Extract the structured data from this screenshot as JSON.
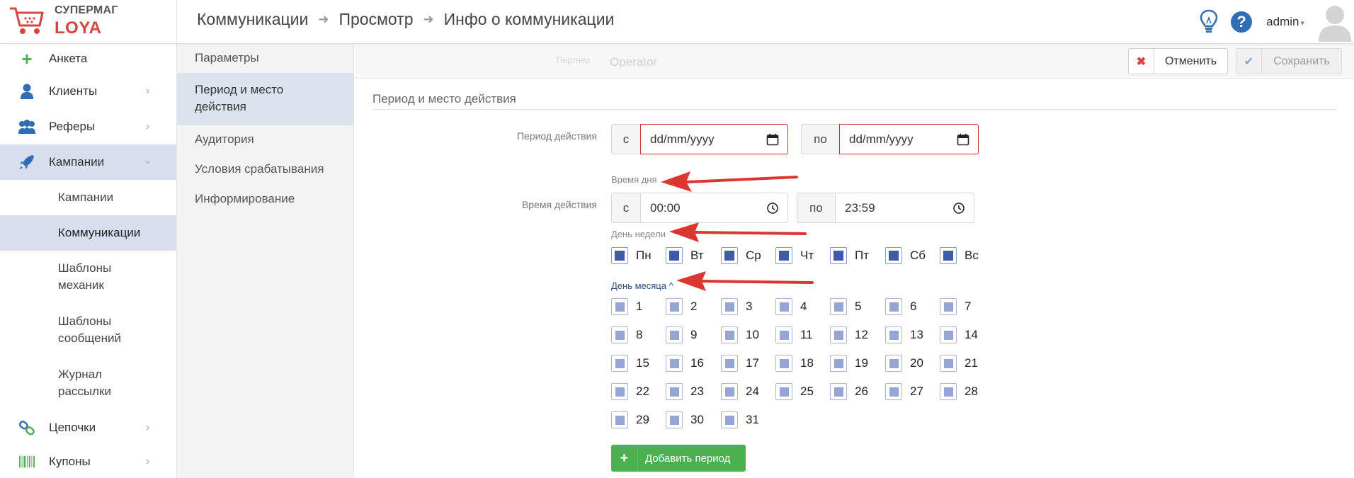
{
  "brand": {
    "line1": "СУПЕРМАГ",
    "line2": "LOYA",
    "accent": "#d9443f"
  },
  "breadcrumbs": [
    "Коммуникации",
    "Просмотр",
    "Инфо о коммуникации"
  ],
  "header": {
    "user": "admin"
  },
  "sidebar": {
    "items": [
      {
        "label": "Анкета",
        "icon": "plus-icon"
      },
      {
        "label": "Клиенты",
        "icon": "user-icon"
      },
      {
        "label": "Реферы",
        "icon": "users-icon"
      },
      {
        "label": "Кампании",
        "icon": "rocket-icon",
        "active": true
      }
    ],
    "subitems": [
      {
        "label": "Кампании"
      },
      {
        "label": "Коммуникации",
        "active": true
      },
      {
        "label": "Шаблоны механик"
      },
      {
        "label": "Шаблоны сообщений"
      },
      {
        "label": "Журнал рассылки"
      }
    ],
    "bottom": [
      {
        "label": "Цепочки",
        "icon": "chain-icon"
      },
      {
        "label": "Купоны",
        "icon": "barcode-icon"
      }
    ]
  },
  "submenu": {
    "items": [
      {
        "label": "Параметры"
      },
      {
        "label": "Период и место действия",
        "active": true
      },
      {
        "label": "Аудитория"
      },
      {
        "label": "Условия срабатывания"
      },
      {
        "label": "Информирование"
      }
    ]
  },
  "actionbar": {
    "partner_label": "Партнер",
    "partner_value": "Operator",
    "cancel": "Отменить",
    "save": "Сохранить"
  },
  "form": {
    "section_title": "Период и место действия",
    "period": {
      "label": "Период действия",
      "from_prefix": "с",
      "from_placeholder": "dd/mm/yyyy",
      "to_prefix": "по",
      "to_placeholder": "dd/mm/yyyy"
    },
    "time": {
      "hint": "Время дня",
      "label": "Время действия",
      "from_prefix": "с",
      "from_value": "00:00",
      "to_prefix": "по",
      "to_value": "23:59"
    },
    "weekdays": {
      "hint": "День недели",
      "days": [
        "Пн",
        "Вт",
        "Ср",
        "Чт",
        "Пт",
        "Сб",
        "Вс"
      ]
    },
    "monthdays": {
      "hint": "День месяца",
      "days": [
        "1",
        "2",
        "3",
        "4",
        "5",
        "6",
        "7",
        "8",
        "9",
        "10",
        "11",
        "12",
        "13",
        "14",
        "15",
        "16",
        "17",
        "18",
        "19",
        "20",
        "21",
        "22",
        "23",
        "24",
        "25",
        "26",
        "27",
        "28",
        "29",
        "30",
        "31"
      ]
    },
    "add_period": "Добавить период"
  }
}
